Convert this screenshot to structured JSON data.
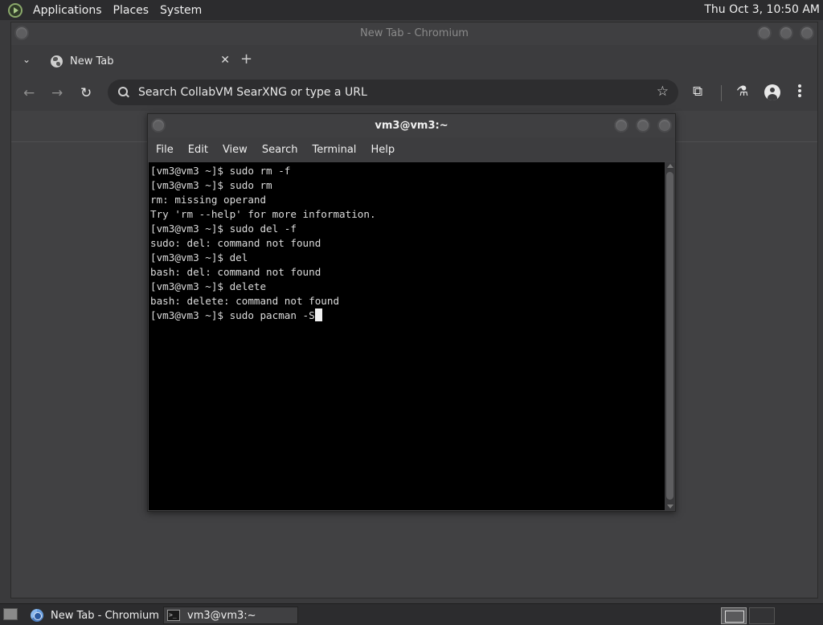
{
  "top_panel": {
    "menus": [
      "Applications",
      "Places",
      "System"
    ],
    "clock": "Thu Oct  3, 10:50 AM"
  },
  "chromium": {
    "window_title": "New Tab - Chromium",
    "tab": {
      "label": "New Tab",
      "close": "✕"
    },
    "new_tab": "+",
    "tab_list": "⌄",
    "omnibox_placeholder": "Search CollabVM SearXNG or type a URL",
    "icons": [
      "back-arrow-icon",
      "forward-arrow-icon",
      "reload-icon",
      "search-icon",
      "bookmark-star-icon",
      "extensions-icon",
      "labs-flask-icon",
      "profile-avatar-icon",
      "more-menu-icon"
    ]
  },
  "terminal": {
    "title": "vm3@vm3:~",
    "menus": [
      "File",
      "Edit",
      "View",
      "Search",
      "Terminal",
      "Help"
    ],
    "lines": [
      "[vm3@vm3 ~]$ sudo rm -f",
      "[vm3@vm3 ~]$ sudo rm",
      "rm: missing operand",
      "Try 'rm --help' for more information.",
      "[vm3@vm3 ~]$ sudo del -f",
      "sudo: del: command not found",
      "[vm3@vm3 ~]$ del",
      "bash: del: command not found",
      "[vm3@vm3 ~]$ delete",
      "bash: delete: command not found"
    ],
    "prompt_line": "[vm3@vm3 ~]$ sudo pacman -S"
  },
  "taskbar": {
    "tasks": [
      {
        "label": "New Tab - Chromium",
        "icon": "chromium-icon",
        "active": false
      },
      {
        "label": "vm3@vm3:~",
        "icon": "terminal-icon",
        "active": true
      }
    ]
  },
  "colors": {
    "panel": "#2c2c2e",
    "window": "#3f3f41",
    "terminal_bg": "#000000",
    "terminal_fg": "#dcdcdc"
  }
}
